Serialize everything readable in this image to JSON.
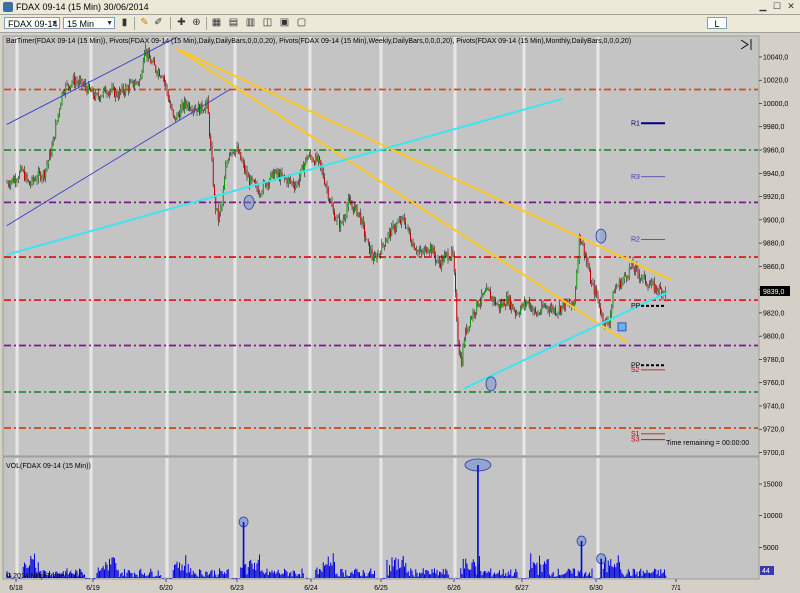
{
  "window": {
    "title": "FDAX 09-14 (15 Min)  30/06/2014"
  },
  "toolbar": {
    "instrument": "FDAX 09-14",
    "interval": "15 Min",
    "right_button": "L"
  },
  "panels": {
    "price_header": "BarTimer(FDAX 09-14 (15 Min)), Pivots(FDAX 09-14 (15 Min),Daily,DailyBars,0,0,0,20), Pivots(FDAX 09-14 (15 Min),Weekly,DailyBars,0,0,0,20), Pivots(FDAX 09-14 (15 Min),Monthly,DailyBars,0,0,0,20)",
    "volume_header": "VOL(FDAX 09-14 (15 Min))",
    "time_remaining": "Time remaining = 00:00:00",
    "copyright": "© 2014 NinjaTrader, LLC",
    "last_price_label": "9839,0",
    "last_volume_label": "44"
  },
  "chart_data": [
    {
      "type": "candlestick",
      "x_ticks": [
        "6/18",
        "6/19",
        "6/20",
        "6/23",
        "6/24",
        "6/25",
        "6/26",
        "6/27",
        "6/30",
        "7/1"
      ],
      "y_ticks": [
        "10040,0",
        "10020,0",
        "10000,0",
        "9980,0",
        "9960,0",
        "9940,0",
        "9920,0",
        "9900,0",
        "9880,0",
        "9860,0",
        "9840,0",
        "9820,0",
        "9800,0",
        "9780,0",
        "9760,0",
        "9740,0",
        "9720,0",
        "9700,0"
      ],
      "ylim": [
        9697,
        10058
      ],
      "path_points": [
        [
          0.0,
          9932
        ],
        [
          0.02,
          9935
        ],
        [
          0.04,
          9942
        ],
        [
          0.06,
          9930
        ],
        [
          0.08,
          9937
        ],
        [
          0.1,
          9940
        ],
        [
          0.12,
          9960
        ],
        [
          0.15,
          10012
        ],
        [
          0.18,
          10020
        ],
        [
          0.21,
          10015
        ],
        [
          0.24,
          10005
        ],
        [
          0.27,
          10012
        ],
        [
          0.3,
          10008
        ],
        [
          0.33,
          10015
        ],
        [
          0.36,
          10020
        ],
        [
          0.37,
          10049
        ],
        [
          0.38,
          10040
        ],
        [
          0.4,
          10030
        ],
        [
          0.42,
          10025
        ],
        [
          0.45,
          9985
        ],
        [
          0.48,
          10000
        ],
        [
          0.52,
          9995
        ],
        [
          0.54,
          10000
        ],
        [
          0.56,
          9915
        ],
        [
          0.57,
          9900
        ],
        [
          0.58,
          9915
        ],
        [
          0.59,
          9945
        ],
        [
          0.6,
          9960
        ],
        [
          0.62,
          9960
        ],
        [
          0.65,
          9935
        ],
        [
          0.68,
          9925
        ],
        [
          0.72,
          9940
        ],
        [
          0.75,
          9935
        ],
        [
          0.78,
          9930
        ],
        [
          0.81,
          9955
        ],
        [
          0.84,
          9950
        ],
        [
          0.86,
          9930
        ],
        [
          0.88,
          9905
        ],
        [
          0.9,
          9895
        ],
        [
          0.92,
          9915
        ],
        [
          0.95,
          9905
        ],
        [
          0.97,
          9880
        ],
        [
          0.99,
          9865
        ],
        [
          1.0,
          9870
        ]
      ],
      "path_points_day2": [
        [
          0.0,
          9870
        ],
        [
          0.03,
          9885
        ],
        [
          0.06,
          9895
        ],
        [
          0.09,
          9900
        ],
        [
          0.12,
          9880
        ],
        [
          0.15,
          9870
        ],
        [
          0.18,
          9878
        ],
        [
          0.21,
          9862
        ],
        [
          0.24,
          9870
        ],
        [
          0.26,
          9870
        ],
        [
          0.28,
          9790
        ],
        [
          0.29,
          9777
        ],
        [
          0.3,
          9800
        ],
        [
          0.32,
          9815
        ],
        [
          0.35,
          9830
        ],
        [
          0.38,
          9838
        ],
        [
          0.42,
          9825
        ],
        [
          0.45,
          9832
        ],
        [
          0.48,
          9820
        ],
        [
          0.52,
          9830
        ],
        [
          0.55,
          9818
        ],
        [
          0.58,
          9826
        ],
        [
          0.62,
          9822
        ],
        [
          0.65,
          9828
        ],
        [
          0.68,
          9825
        ],
        [
          0.7,
          9888
        ],
        [
          0.72,
          9870
        ],
        [
          0.74,
          9845
        ],
        [
          0.76,
          9835
        ],
        [
          0.78,
          9815
        ],
        [
          0.8,
          9810
        ],
        [
          0.82,
          9840
        ],
        [
          0.85,
          9848
        ],
        [
          0.88,
          9860
        ],
        [
          0.91,
          9852
        ],
        [
          0.94,
          9845
        ],
        [
          0.97,
          9840
        ],
        [
          1.0,
          9839
        ]
      ],
      "horizontal_levels": [
        {
          "value": 10012,
          "color": "#c8501e",
          "style": "dash-dot"
        },
        {
          "value": 9960,
          "color": "#2e8b3a",
          "style": "dash-dot"
        },
        {
          "value": 9915,
          "color": "#7a1a8a",
          "style": "dash-dot"
        },
        {
          "value": 9868,
          "color": "#e02020",
          "style": "dash-dot"
        },
        {
          "value": 9831,
          "color": "#e02020",
          "style": "dash-dot"
        },
        {
          "value": 9792,
          "color": "#7a1a8a",
          "style": "dash-dot"
        },
        {
          "value": 9752,
          "color": "#2e8b3a",
          "style": "dash-dot"
        },
        {
          "value": 9721,
          "color": "#c8501e",
          "style": "dash-dot"
        }
      ],
      "pivot_labels": [
        {
          "label": "R1",
          "value": 9983,
          "color": "#000080"
        },
        {
          "label": "R3",
          "value": 9937,
          "color": "#3a3ab0"
        },
        {
          "label": "R2",
          "value": 9883,
          "color": "#3a3ab0"
        },
        {
          "label": "PP",
          "value": 9826,
          "color": "#000000"
        },
        {
          "label": "PP",
          "value": 9775,
          "color": "#000000"
        },
        {
          "label": "S2",
          "value": 9771,
          "color": "#c00000"
        },
        {
          "label": "S1",
          "value": 9716,
          "color": "#c00000"
        },
        {
          "label": "S3",
          "value": 9711,
          "color": "#c00000"
        }
      ],
      "trend_lines": [
        {
          "color": "#ffc820",
          "from": [
            0.23,
            10047
          ],
          "to": [
            0.825,
            9795
          ]
        },
        {
          "color": "#ffc820",
          "from": [
            0.23,
            10047
          ],
          "to": [
            0.885,
            9848
          ]
        },
        {
          "color": "#3ce6f0",
          "from": [
            0.005,
            9870
          ],
          "to": [
            0.74,
            10004
          ]
        },
        {
          "color": "#3ce6f0",
          "from": [
            0.61,
            9755
          ],
          "to": [
            0.88,
            9838
          ]
        },
        {
          "color": "#3a3ad0",
          "from": [
            0.005,
            9982
          ],
          "to": [
            0.23,
            10057
          ]
        },
        {
          "color": "#3a3ad0",
          "from": [
            0.005,
            9895
          ],
          "to": [
            0.3,
            10012
          ]
        }
      ]
    },
    {
      "type": "bar",
      "series_label": "VOL",
      "y_ticks": [
        "15000",
        "10000",
        "5000"
      ],
      "ylim": [
        0,
        18000
      ],
      "spikes": [
        {
          "pos": 0.305,
          "value": 9000
        },
        {
          "pos": 0.615,
          "value": 18000
        },
        {
          "pos": 0.752,
          "value": 6000
        },
        {
          "pos": 0.778,
          "value": 3200
        }
      ]
    }
  ]
}
